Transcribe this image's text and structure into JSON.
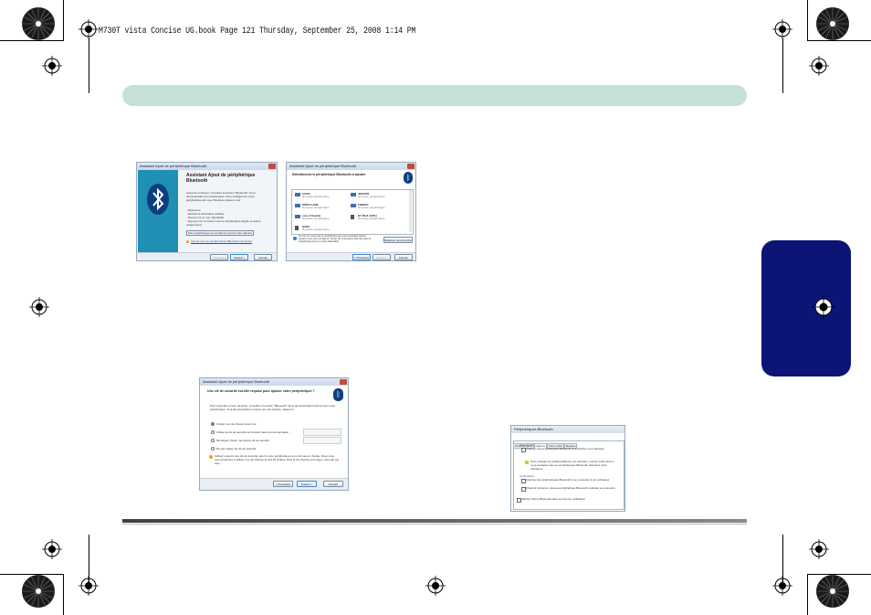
{
  "header": {
    "print_line": "M730T vista Concise UG.book  Page 121  Thursday, September 25, 2008  1:14 PM"
  },
  "win1": {
    "title": "Assistant Ajout de périphérique Bluetooth",
    "heading": "Assistant Ajout de périphérique Bluetooth",
    "intro": "Avant de continuer, consultez la section \"Bluetooth\" de la documentation du périphérique. Vous configurerez votre périphérique afin que Windows puisse le voir :",
    "list": [
      "- Allumez-le",
      "- Rendez-le détectable (visible)",
      "- Donnez-lui un nom (facultatif)",
      "- Appuyez sur le bouton sous le périphérique (Apple et autres uniquement)"
    ],
    "checkbox": "Mon périphérique est configuré et prêt à être détecté",
    "link": "Ajouter que les périphériques Bluetooth connectés",
    "buttons": [
      "< Précédent",
      "Suivant >",
      "Annuler"
    ]
  },
  "win2": {
    "title": "Assistant Ajout de périphérique Bluetooth",
    "heading": "Sélectionnez le périphérique Bluetooth à ajouter",
    "devices": [
      {
        "name": "ACER",
        "sub": "Nouveau périphérique"
      },
      {
        "name": "JENSON",
        "sub": "Nouveau périphérique"
      },
      {
        "name": "DIRKCLARK",
        "sub": "Nouveau périphérique"
      },
      {
        "name": "FBBDIO",
        "sub": "Nouveau périphérique"
      },
      {
        "name": "one-of.flexible",
        "sub": "Nouveau périphérique"
      },
      {
        "name": "BT MLR-41854",
        "sub": "Nouveau périphérique"
      },
      {
        "name": "HXBS",
        "sub": "Nouveau périphérique"
      }
    ],
    "note": "Si vous ne voyez pas le périphérique que vous souhaitez ajouter, assurez-vous qu'il est allumé. Suivez les instructions fournies avec le périphérique pour le rendre détectable.",
    "rescan": "Relancer la recherche",
    "buttons": [
      "< Précédent",
      "Suivant >",
      "Annuler"
    ]
  },
  "win3": {
    "title": "Assistant Ajout de périphérique Bluetooth",
    "heading": "Une clé de sécurité est-elle requise pour ajouter votre périphérique ?",
    "intro": "Pour répondre à cette question, consultez la section \"Bluetooth\" de la documentation fournie avec votre périphérique. Si la documentation contient une clé d'accès, utilisez-la.",
    "options": [
      "Choisir une clé d'accès pour moi",
      "Utiliser la clé de sécurité se trouvant dans la documentation :",
      "Me laisser choisir ma propre clé de sécurité :",
      "Ne pas utiliser de clé de sécurité"
    ],
    "note": "Utilisez toujours une clé de sécurité, sauf si votre périphérique ne prend pas en charge. Nous vous recommandons d'utiliser une clé d'accès de 8 à 16 chiffres. Plus la clé d'accès est longue, plus elle est sûre.",
    "buttons": [
      "< Précédent",
      "Suivant >",
      "Annuler"
    ]
  },
  "win4": {
    "title": "Périphériques Bluetooth",
    "tabs": [
      "Périphériques",
      "Options",
      "Ports COM",
      "Matériel"
    ],
    "section1": "Découverte",
    "check1": "Autoriser les périphériques Bluetooth à rechercher cet ordinateur",
    "warning": "Pour protéger la confidentialité de vos données, cochez cette case si vous souhaitez que les périphériques Bluetooth détectent votre ordinateur.",
    "section2": "Connexions",
    "check2": "Autoriser les périphériques Bluetooth à se connecter à cet ordinateur",
    "check3": "M'avertir lorsqu'un nouveau périphérique Bluetooth souhaite se connecter",
    "check4": "Afficher l'icône Bluetooth dans la zone de notification"
  },
  "colors": {
    "header_band": "#c7dfd9",
    "side_tab": "#0c1475",
    "bluetooth_panel": "#1f8fb5"
  }
}
